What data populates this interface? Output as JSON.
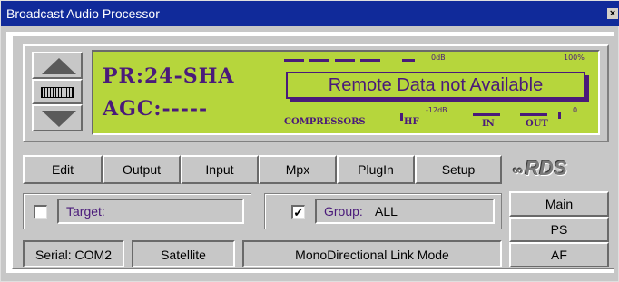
{
  "window": {
    "title": "Broadcast Audio Processor",
    "close_glyph": "×"
  },
  "lcd": {
    "line1": "PR:24-SHA",
    "line2": "AGC:-----",
    "remote_message": "Remote Data not Available",
    "scale_0db": "0dB",
    "scale_100": "100%",
    "scale_minus12": "-12dB",
    "scale_0": "0",
    "label_compressors": "COMPRESSORS",
    "label_hf": "HF",
    "label_in": "IN",
    "label_out": "OUT",
    "text_color": "#4a1a7a",
    "background_color": "#b6d63c"
  },
  "toolbar": {
    "buttons": [
      "Edit",
      "Output",
      "Input",
      "Mpx",
      "PlugIn",
      "Setup"
    ]
  },
  "rds": {
    "logo_mark": "∞",
    "logo_text": "RDS"
  },
  "target": {
    "label": "Target:",
    "checked": false,
    "check_glyph": ""
  },
  "group": {
    "label": "Group:",
    "value": "ALL",
    "checked": true,
    "check_glyph": "✓"
  },
  "status": {
    "serial": "Serial: COM2",
    "source": "Satellite",
    "mode": "MonoDirectional Link Mode"
  },
  "side_buttons": [
    "Main",
    "PS",
    "AF"
  ],
  "colors": {
    "titlebar": "#102a9a",
    "window": "#c7c7c7"
  }
}
